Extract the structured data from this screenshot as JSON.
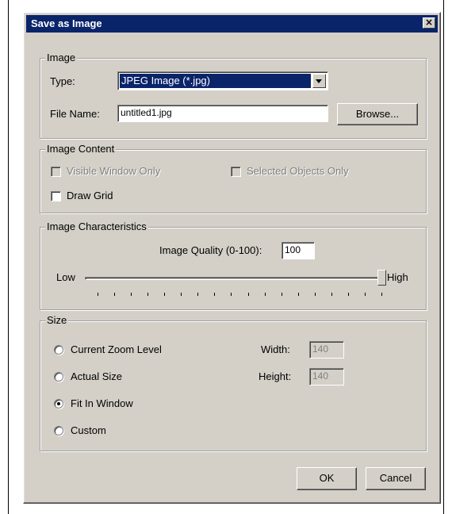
{
  "dialog": {
    "title": "Save as Image",
    "close_glyph": "×"
  },
  "image_group": {
    "legend": "Image",
    "type_label": "Type:",
    "type_value": "JPEG Image (*.jpg)",
    "filename_label": "File Name:",
    "filename_value": "untitled1.jpg",
    "browse_label": "Browse..."
  },
  "content_group": {
    "legend": "Image Content",
    "visible_window_only": {
      "label": "Visible Window Only",
      "checked": false,
      "enabled": false
    },
    "selected_objects_only": {
      "label": "Selected Objects Only",
      "checked": false,
      "enabled": false
    },
    "draw_grid": {
      "label": "Draw Grid",
      "checked": false,
      "enabled": true
    }
  },
  "characteristics_group": {
    "legend": "Image Characteristics",
    "quality_label": "Image Quality (0-100):",
    "quality_value": "100",
    "low_label": "Low",
    "high_label": "High",
    "slider_min": 0,
    "slider_max": 100,
    "slider_value": 100,
    "tick_count": 18
  },
  "size_group": {
    "legend": "Size",
    "options": [
      {
        "label": "Current Zoom Level",
        "checked": false
      },
      {
        "label": "Actual Size",
        "checked": false
      },
      {
        "label": "Fit In Window",
        "checked": true
      },
      {
        "label": "Custom",
        "checked": false
      }
    ],
    "width_label": "Width:",
    "width_value": "140",
    "height_label": "Height:",
    "height_value": "140"
  },
  "footer": {
    "ok_label": "OK",
    "cancel_label": "Cancel"
  }
}
